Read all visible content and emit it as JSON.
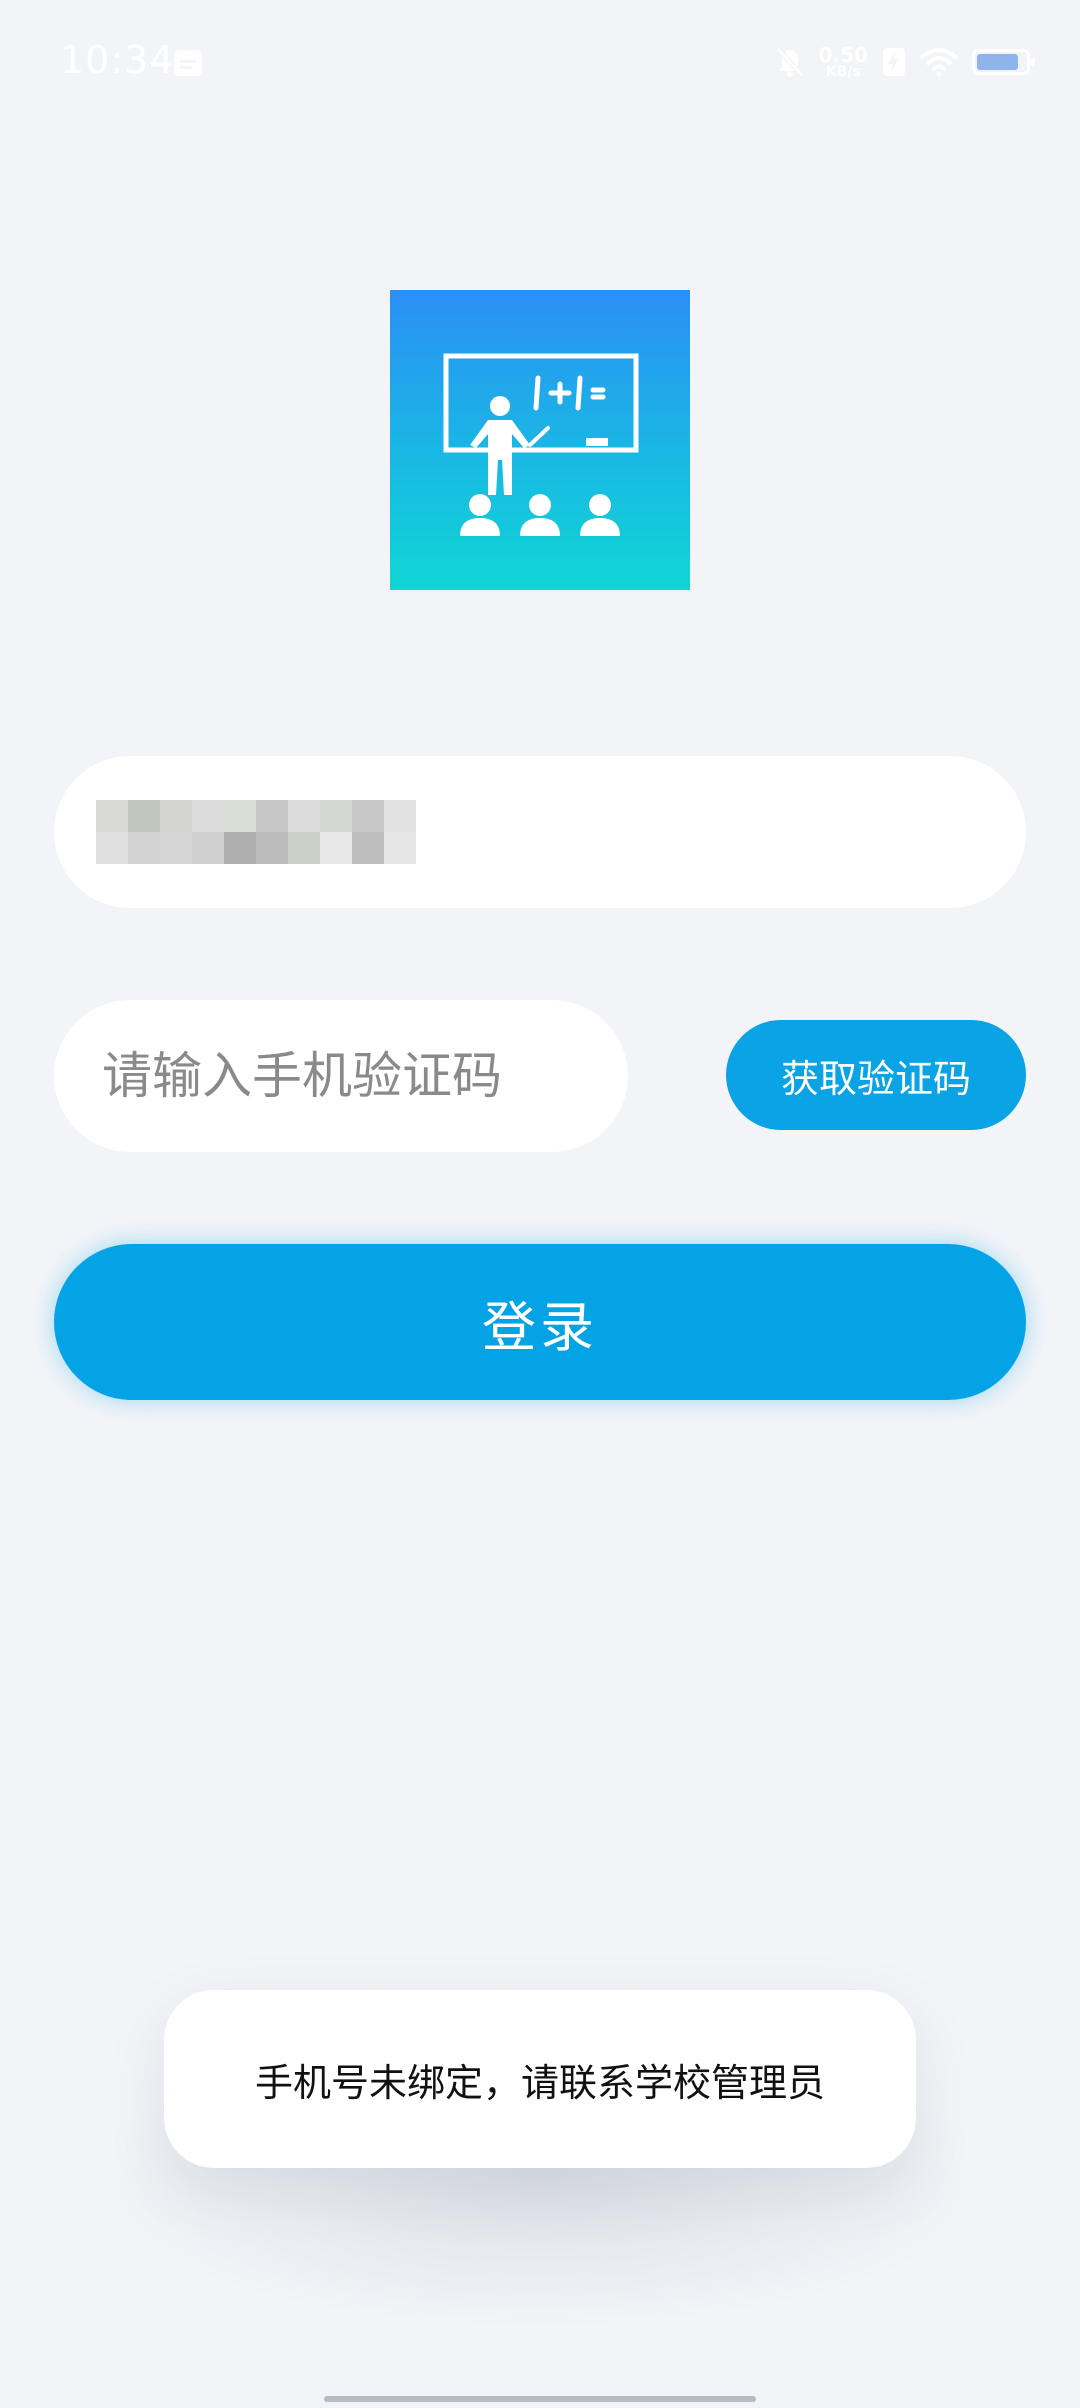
{
  "status_bar": {
    "time": "10:34",
    "net_speed_value": "0.50",
    "net_speed_unit": "KB/s",
    "battery_level": 0.85,
    "icons": [
      "calendar-icon",
      "mute-icon",
      "network-speed",
      "battery-saver-icon",
      "wifi-icon",
      "battery-icon"
    ]
  },
  "logo": {
    "icon": "teacher-classroom-icon",
    "board_text": "1+1="
  },
  "phone_field": {
    "value_obscured": true
  },
  "code_field": {
    "placeholder": "请输入手机验证码",
    "value": ""
  },
  "get_code_button": {
    "label": "获取验证码"
  },
  "login_button": {
    "label": "登录"
  },
  "toast": {
    "message": "手机号未绑定，请联系学校管理员"
  },
  "colors": {
    "background": "#f2f4f8",
    "primary": "#03a3e6",
    "logo_top": "#2b8ff6",
    "logo_bottom": "#10d6d4"
  }
}
